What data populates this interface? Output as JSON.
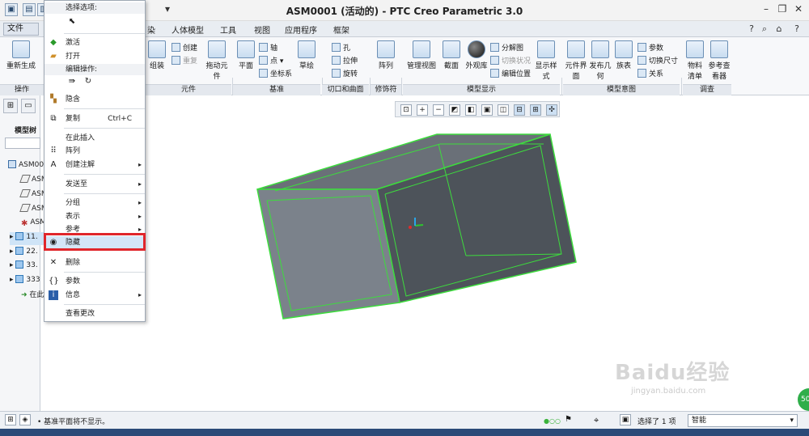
{
  "window": {
    "title": "ASM0001 (活动的) - PTC Creo Parametric 3.0",
    "controls": [
      "minimize-icon",
      "restore-icon",
      "close-icon"
    ]
  },
  "tabs": [
    {
      "label": "文件"
    },
    {
      "label": "染"
    },
    {
      "label": "人体模型"
    },
    {
      "label": "工具"
    },
    {
      "label": "视图"
    },
    {
      "label": "应用程序"
    },
    {
      "label": "框架"
    }
  ],
  "ribbon": {
    "regen_label": "重新生成",
    "ops_group": "操作",
    "assemble_label": "组装",
    "create_label": "创建",
    "repeat_label": "重复",
    "drag_label": "拖动元件",
    "plane_label": "平面",
    "axis_label": "轴",
    "point_label": "点",
    "csys_label": "坐标系",
    "sketch_label": "草绘",
    "hole_label": "孔",
    "extrude_label": "拉伸",
    "revolve_label": "旋转",
    "pattern_label": "阵列",
    "manage_view_label": "管理视图",
    "section_label": "截面",
    "appearance_label": "外观库",
    "explode_label": "分解图",
    "toggle_state_label": "切换状况",
    "edit_position_label": "编辑位置",
    "display_style_label": "显示样式",
    "comp_interface_label": "元件界面",
    "publish_geom_label": "发布几何",
    "table_label": "族表",
    "params_label": "参数",
    "switch_dim_label": "切换尺寸",
    "relations_label": "关系",
    "bom_label": "物料清单",
    "ref_viewer_label": "参考查看器",
    "groups": {
      "component": "元件",
      "datum": "基准",
      "cut_surface": "切口和曲面",
      "modifiers": "修饰符",
      "model_display": "模型显示",
      "model_intent": "模型意图",
      "investigate": "调查"
    }
  },
  "left_panel": {
    "title": "模型树",
    "tree": [
      {
        "label": "ASM00",
        "icon": "assembly-icon"
      },
      {
        "label": "ASM",
        "icon": "datum-plane-icon"
      },
      {
        "label": "ASM",
        "icon": "datum-plane-icon"
      },
      {
        "label": "ASM",
        "icon": "datum-plane-icon"
      },
      {
        "label": "ASM",
        "icon": "csys-icon"
      },
      {
        "label": "11.",
        "icon": "part-icon"
      },
      {
        "label": "22.",
        "icon": "part-icon"
      },
      {
        "label": "33.",
        "icon": "part-icon"
      },
      {
        "label": "333",
        "icon": "part-icon"
      },
      {
        "label": "在此",
        "icon": "insert-here-icon"
      }
    ]
  },
  "context_menu": {
    "select_options": "选择选项:",
    "edit_ops": "编辑操作:",
    "items": {
      "activate": "激活",
      "open": "打开",
      "hide_small": "隐含",
      "copy": "复制",
      "copy_shortcut": "Ctrl+C",
      "insert_here": "在此插入",
      "pattern": "阵列",
      "create_note": "创建注解",
      "send_to": "发送至",
      "group": "分组",
      "represent": "表示",
      "reference": "参考",
      "hide": "隐藏",
      "delete": "删除",
      "parameters": "参数",
      "info": "信息",
      "view_changes": "查看更改"
    }
  },
  "status": {
    "message": "基准平面将不显示。",
    "selection": "选择了 1 项",
    "filter": "智能"
  },
  "colors": {
    "highlight": "#d4e6f8",
    "redbox": "#e0262b",
    "model_face": "#5a6068",
    "model_edge": "#3ddc3d"
  },
  "watermark": {
    "text": "Baidu经验",
    "sub": "jingyan.baidu.com"
  }
}
